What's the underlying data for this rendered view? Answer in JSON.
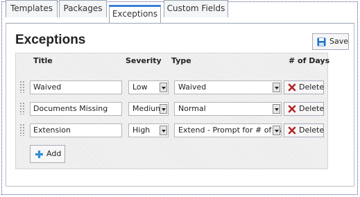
{
  "tabs": [
    {
      "label": "Templates",
      "active": false
    },
    {
      "label": "Packages",
      "active": false
    },
    {
      "label": "Exceptions",
      "active": true
    },
    {
      "label": "Custom Fields",
      "active": false
    }
  ],
  "page_title": "Exceptions",
  "toolbar": {
    "save_label": "Save",
    "save_icon": "floppy-disk-icon"
  },
  "table": {
    "columns": [
      "Title",
      "Severity",
      "Type",
      "# of Days"
    ],
    "rows": [
      {
        "title": "Waived",
        "severity": "Low",
        "type": "Waived",
        "delete_label": "Delete"
      },
      {
        "title": "Documents Missing",
        "severity": "Medium",
        "type": "Normal",
        "delete_label": "Delete"
      },
      {
        "title": "Extension",
        "severity": "High",
        "type": "Extend - Prompt for # of Days",
        "delete_label": "Delete"
      }
    ]
  },
  "add_label": "Add",
  "colors": {
    "accent": "#3a7fd0",
    "delete": "#b5262b",
    "add": "#2f8fd8"
  }
}
